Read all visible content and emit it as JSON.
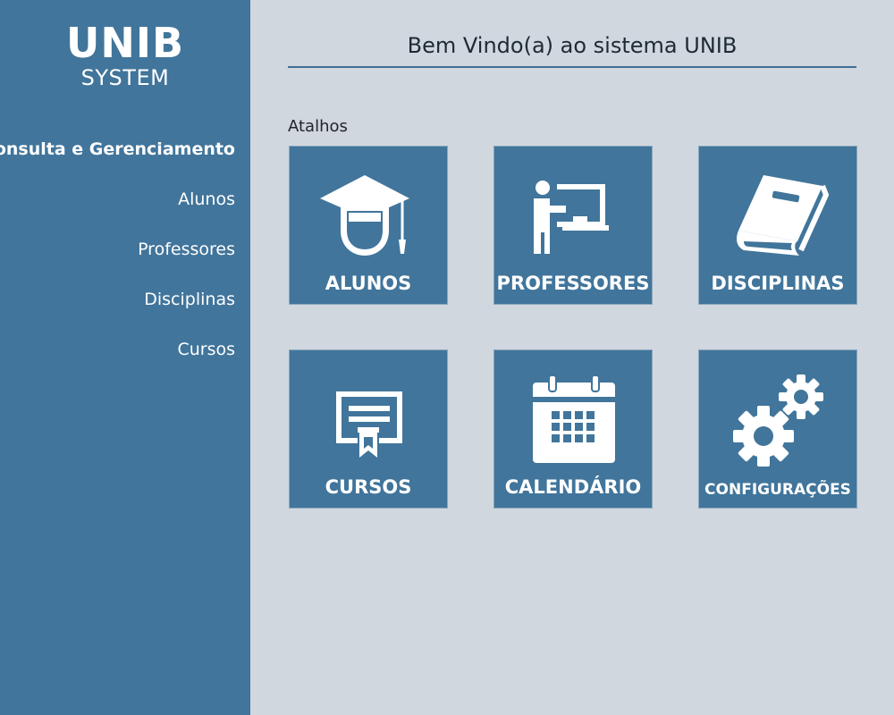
{
  "brand": {
    "title": "UNIB",
    "subtitle": "SYSTEM"
  },
  "sidebar": {
    "section_title": "Consulta e Gerenciamento",
    "items": [
      {
        "label": "Alunos"
      },
      {
        "label": "Professores"
      },
      {
        "label": "Disciplinas"
      },
      {
        "label": "Cursos"
      }
    ]
  },
  "main": {
    "title": "Bem Vindo(a) ao sistema UNIB",
    "shortcuts_label": "Atalhos",
    "tiles": [
      {
        "label": "ALUNOS",
        "icon": "graduation-cap-icon"
      },
      {
        "label": "PROFESSORES",
        "icon": "teacher-board-icon"
      },
      {
        "label": "DISCIPLINAS",
        "icon": "book-icon"
      },
      {
        "label": "CURSOS",
        "icon": "certificate-icon"
      },
      {
        "label": "CALENDÁRIO",
        "icon": "calendar-icon"
      },
      {
        "label": "CONFIGURAÇÕES",
        "icon": "gears-icon"
      }
    ]
  },
  "colors": {
    "sidebar_bg": "#41759b",
    "page_bg": "#d0d7de",
    "tile_bg": "#41759b",
    "accent_rule": "#3f6f93"
  }
}
